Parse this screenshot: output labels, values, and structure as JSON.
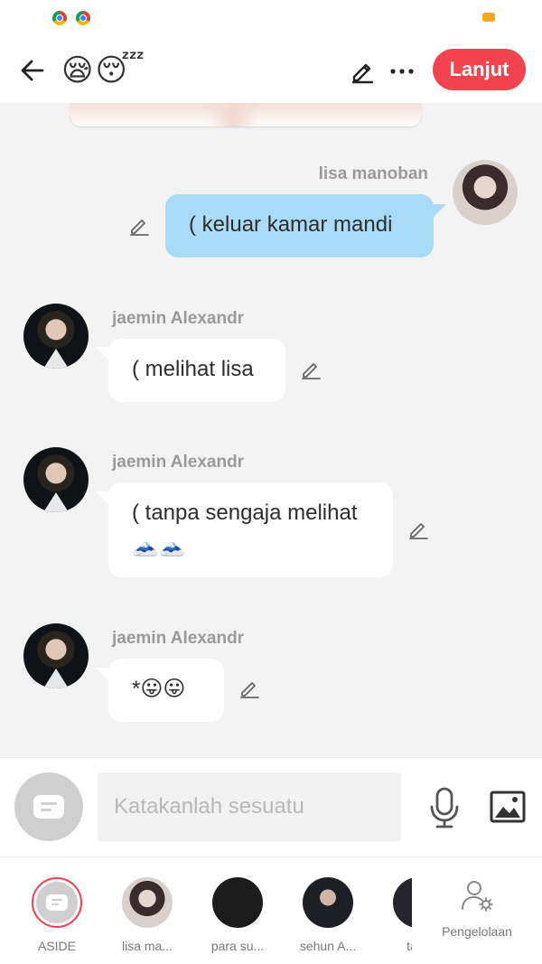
{
  "header": {
    "title_emoji": "😪😴",
    "next_label": "Lanjut"
  },
  "messages": [
    {
      "sender": "lisa manoban",
      "text": "( keluar kamar mandi",
      "self": true
    },
    {
      "sender": "jaemin Alexandr",
      "text": "( melihat lisa",
      "self": false
    },
    {
      "sender": "jaemin Alexandr",
      "text": "( tanpa sengaja melihat 🗻🗻",
      "self": false
    },
    {
      "sender": "jaemin Alexandr",
      "text": "*😛😛",
      "self": false
    }
  ],
  "composer": {
    "placeholder": "Katakanlah sesuatu"
  },
  "characters": [
    {
      "label": "ASIDE"
    },
    {
      "label": "lisa ma..."
    },
    {
      "label": "para su..."
    },
    {
      "label": "sehun A..."
    },
    {
      "label": "taeil"
    }
  ],
  "manage_label": "Pengelolaan",
  "colors": {
    "accent": "#f2434e",
    "my_bubble": "#a9dbf7",
    "other_bubble": "#ffffff",
    "background": "#f3f3f3"
  },
  "icons": [
    "back-arrow-icon",
    "pencil-icon",
    "more-icon",
    "microphone-icon",
    "image-icon",
    "chat-bubble-icon",
    "user-gear-icon"
  ]
}
